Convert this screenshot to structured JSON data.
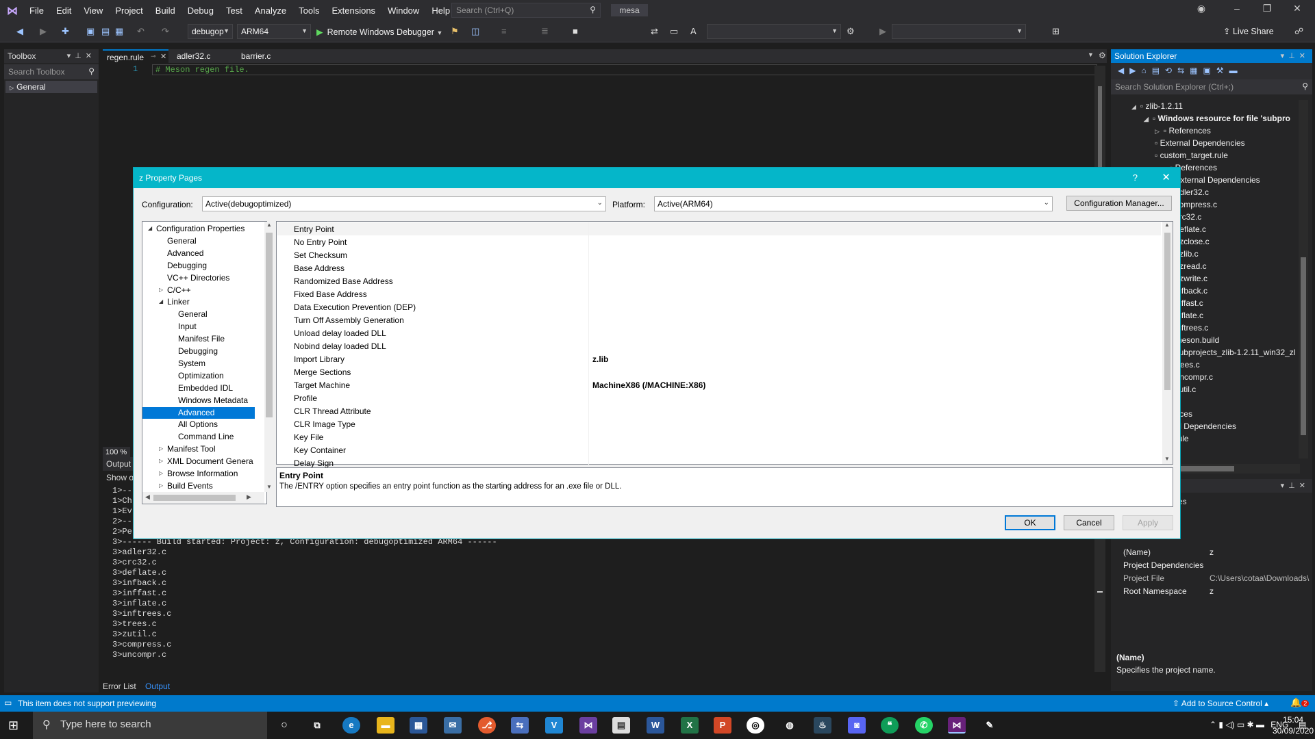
{
  "titlebar": {
    "menu": [
      "File",
      "Edit",
      "View",
      "Project",
      "Build",
      "Debug",
      "Test",
      "Analyze",
      "Tools",
      "Extensions",
      "Window",
      "Help"
    ],
    "search_placeholder": "Search (Ctrl+Q)",
    "solution_name": "mesa"
  },
  "toolbar": {
    "config": "debugop",
    "platform": "ARM64",
    "run_label": "Remote Windows Debugger",
    "live_share": "Live Share"
  },
  "toolbox": {
    "title": "Toolbox",
    "search_placeholder": "Search Toolbox",
    "group": "General"
  },
  "editor": {
    "tabs": [
      "regen.rule",
      "adler32.c",
      "barrier.c"
    ],
    "line_number": "1",
    "code": "# Meson regen file.",
    "zoom": "100 %"
  },
  "output": {
    "title": "Output",
    "show_from": "Show o",
    "lines": [
      "1>---",
      "1>Ch",
      "1>Ev",
      "2>---",
      "2>Performing Custom Build Tools",
      "3>------ Build started: Project: z, Configuration: debugoptimized ARM64 ------",
      "3>adler32.c",
      "3>crc32.c",
      "3>deflate.c",
      "3>infback.c",
      "3>inffast.c",
      "3>inflate.c",
      "3>inftrees.c",
      "3>trees.c",
      "3>zutil.c",
      "3>compress.c",
      "3>uncompr.c"
    ],
    "bottom_tabs": [
      "Error List",
      "Output"
    ]
  },
  "solution_explorer": {
    "title": "Solution Explorer",
    "search_placeholder": "Search Solution Explorer (Ctrl+;)",
    "items": [
      {
        "label": "zlib-1.2.11",
        "glyph": "◢"
      },
      {
        "label": "Windows resource for file 'subpro",
        "glyph": "◢"
      },
      {
        "label": "References",
        "glyph": "▷"
      },
      {
        "label": "External Dependencies",
        "glyph": ""
      },
      {
        "label": "custom_target.rule",
        "glyph": ""
      },
      {
        "label": "References",
        "glyph": ""
      },
      {
        "label": "External Dependencies",
        "glyph": ""
      },
      {
        "label": "adler32.c",
        "glyph": ""
      },
      {
        "label": "compress.c",
        "glyph": ""
      },
      {
        "label": "crc32.c",
        "glyph": ""
      },
      {
        "label": "deflate.c",
        "glyph": ""
      },
      {
        "label": "gzclose.c",
        "glyph": ""
      },
      {
        "label": "gzlib.c",
        "glyph": ""
      },
      {
        "label": "gzread.c",
        "glyph": ""
      },
      {
        "label": "gzwrite.c",
        "glyph": ""
      },
      {
        "label": "infback.c",
        "glyph": ""
      },
      {
        "label": "inffast.c",
        "glyph": ""
      },
      {
        "label": "inflate.c",
        "glyph": ""
      },
      {
        "label": "inftrees.c",
        "glyph": ""
      },
      {
        "label": "meson.build",
        "glyph": ""
      },
      {
        "label": "subprojects_zlib-1.2.11_win32_zl",
        "glyph": ""
      },
      {
        "label": "trees.c",
        "glyph": ""
      },
      {
        "label": "uncompr.c",
        "glyph": ""
      },
      {
        "label": "zutil.c",
        "glyph": ""
      },
      {
        "label": "nces",
        "glyph": ""
      },
      {
        "label": "al Dependencies",
        "glyph": ""
      },
      {
        "label": "rule",
        "glyph": ""
      }
    ]
  },
  "properties": {
    "header_fragment": "es",
    "rows": [
      {
        "name": "(Name)",
        "value": "z"
      },
      {
        "name": "Project Dependencies",
        "value": ""
      },
      {
        "name": "Project File",
        "value": "C:\\Users\\cotaa\\Downloads\\"
      },
      {
        "name": "Root Namespace",
        "value": "z"
      }
    ],
    "desc_title": "(Name)",
    "desc_text": "Specifies the project name."
  },
  "statusbar": {
    "message": "This item does not support previewing",
    "source_control": "Add to Source Control",
    "notifications": "2"
  },
  "taskbar": {
    "search_placeholder": "Type here to search",
    "lang": "ENG",
    "time": "15:04",
    "date": "30/09/2020"
  },
  "dialog": {
    "title": "z Property Pages",
    "help": "?",
    "config_label": "Configuration:",
    "config_value": "Active(debugoptimized)",
    "platform_label": "Platform:",
    "platform_value": "Active(ARM64)",
    "config_manager": "Configuration Manager...",
    "tree": [
      {
        "label": "Configuration Properties",
        "level": 0,
        "glyph": "◢"
      },
      {
        "label": "General",
        "level": 1,
        "glyph": ""
      },
      {
        "label": "Advanced",
        "level": 1,
        "glyph": ""
      },
      {
        "label": "Debugging",
        "level": 1,
        "glyph": ""
      },
      {
        "label": "VC++ Directories",
        "level": 1,
        "glyph": ""
      },
      {
        "label": "C/C++",
        "level": 1,
        "glyph": "▷"
      },
      {
        "label": "Linker",
        "level": 1,
        "glyph": "◢"
      },
      {
        "label": "General",
        "level": 2,
        "glyph": ""
      },
      {
        "label": "Input",
        "level": 2,
        "glyph": ""
      },
      {
        "label": "Manifest File",
        "level": 2,
        "glyph": ""
      },
      {
        "label": "Debugging",
        "level": 2,
        "glyph": ""
      },
      {
        "label": "System",
        "level": 2,
        "glyph": ""
      },
      {
        "label": "Optimization",
        "level": 2,
        "glyph": ""
      },
      {
        "label": "Embedded IDL",
        "level": 2,
        "glyph": ""
      },
      {
        "label": "Windows Metadata",
        "level": 2,
        "glyph": ""
      },
      {
        "label": "Advanced",
        "level": 2,
        "glyph": "",
        "selected": true
      },
      {
        "label": "All Options",
        "level": 2,
        "glyph": ""
      },
      {
        "label": "Command Line",
        "level": 2,
        "glyph": ""
      },
      {
        "label": "Manifest Tool",
        "level": 1,
        "glyph": "▷"
      },
      {
        "label": "XML Document Genera",
        "level": 1,
        "glyph": "▷"
      },
      {
        "label": "Browse Information",
        "level": 1,
        "glyph": "▷"
      },
      {
        "label": "Build Events",
        "level": 1,
        "glyph": "▷"
      }
    ],
    "properties": [
      {
        "name": "Entry Point",
        "value": ""
      },
      {
        "name": "No Entry Point",
        "value": ""
      },
      {
        "name": "Set Checksum",
        "value": ""
      },
      {
        "name": "Base Address",
        "value": ""
      },
      {
        "name": "Randomized Base Address",
        "value": ""
      },
      {
        "name": "Fixed Base Address",
        "value": ""
      },
      {
        "name": "Data Execution Prevention (DEP)",
        "value": ""
      },
      {
        "name": "Turn Off Assembly Generation",
        "value": ""
      },
      {
        "name": "Unload delay loaded DLL",
        "value": ""
      },
      {
        "name": "Nobind delay loaded DLL",
        "value": ""
      },
      {
        "name": "Import Library",
        "value": "z.lib"
      },
      {
        "name": "Merge Sections",
        "value": ""
      },
      {
        "name": "Target Machine",
        "value": "MachineX86 (/MACHINE:X86)"
      },
      {
        "name": "Profile",
        "value": ""
      },
      {
        "name": "CLR Thread Attribute",
        "value": ""
      },
      {
        "name": "CLR Image Type",
        "value": ""
      },
      {
        "name": "Key File",
        "value": ""
      },
      {
        "name": "Key Container",
        "value": ""
      },
      {
        "name": "Delay Sign",
        "value": ""
      }
    ],
    "desc_title": "Entry Point",
    "desc_text": "The /ENTRY option specifies an entry point function as the starting address for an .exe file or DLL.",
    "ok": "OK",
    "cancel": "Cancel",
    "apply": "Apply"
  }
}
